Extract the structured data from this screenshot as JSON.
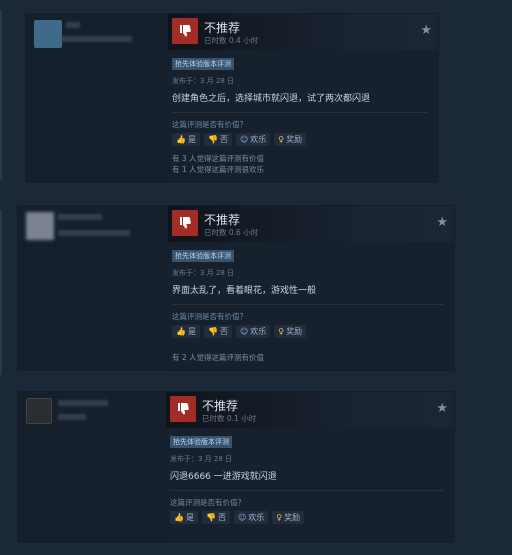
{
  "reviews": [
    {
      "verdict": "不推荐",
      "hours": "已时数 0.4 小时",
      "badge": "抢先体验版本评测",
      "posted": "发布于：3 月 28 日",
      "text": "创建角色之后，选择城市就闪退，试了两次都闪退",
      "helpful_question": "这篇评测是否有价值？",
      "buttons": {
        "yes": "是",
        "no": "否",
        "funny": "欢乐",
        "award": "奖励"
      },
      "stats": [
        "有 3 人觉得这篇评测有价值",
        "有 1 人觉得这篇评测很欢乐"
      ],
      "avatar_color": "#3c6c8a"
    },
    {
      "verdict": "不推荐",
      "hours": "已时数 0.6 小时",
      "badge": "抢先体验版本评测",
      "posted": "发布于：3 月 28 日",
      "text": "界面太乱了，看着眼花，游戏性一般",
      "helpful_question": "这篇评测是否有价值？",
      "buttons": {
        "yes": "是",
        "no": "否",
        "funny": "欢乐",
        "award": "奖励"
      },
      "stats": [
        "有 2 人觉得这篇评测有价值"
      ],
      "avatar_color": "#7b8390"
    },
    {
      "verdict": "不推荐",
      "hours": "已时数 0.1 小时",
      "badge": "抢先体验版本评测",
      "posted": "发布于：3 月 28 日",
      "text": "闪退6666 一进游戏就闪退",
      "helpful_question": "这篇评测是否有价值？",
      "buttons": {
        "yes": "是",
        "no": "否",
        "funny": "欢乐",
        "award": "奖励"
      },
      "stats": [],
      "avatar_color": "#2a2e30"
    }
  ],
  "icons": {
    "thumbs_down": "thumbs-down-icon",
    "star": "star-icon",
    "yes": "thumbs-up-icon",
    "no": "thumbs-down-small-icon",
    "funny": "smiley-icon",
    "award": "award-icon"
  },
  "colors": {
    "background": "#1b2838",
    "verdict_bg": "#a32c26",
    "badge_bg": "#38536e"
  }
}
